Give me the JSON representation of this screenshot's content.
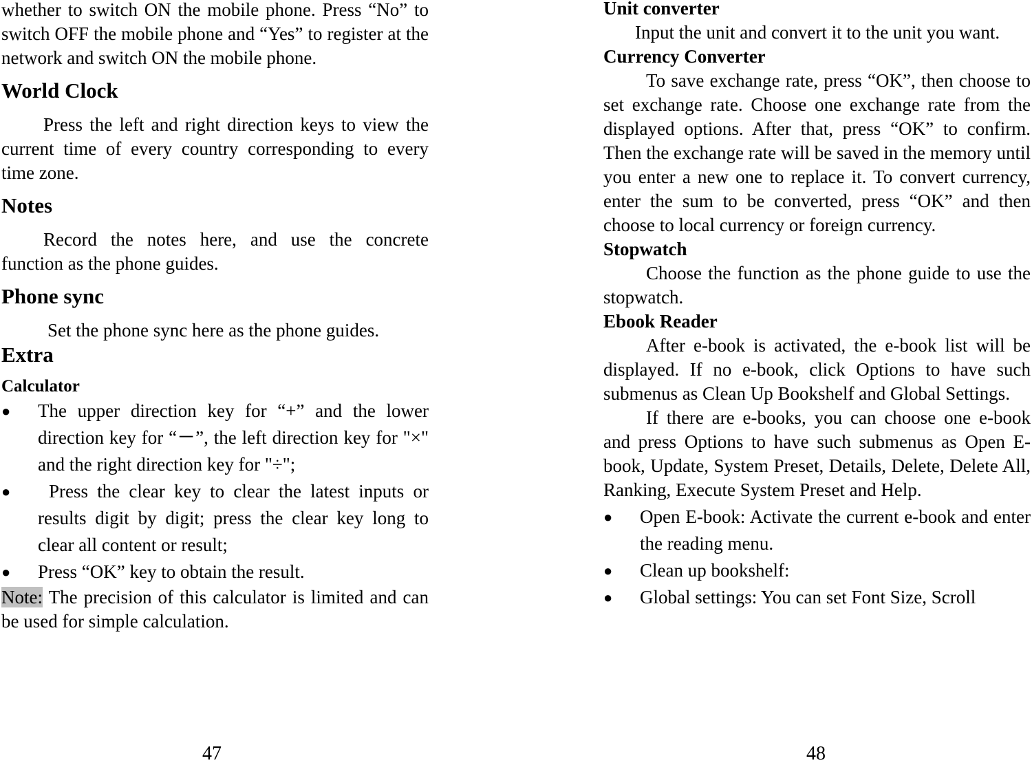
{
  "left_page": {
    "intro_text": "whether to switch ON the mobile phone. Press “No” to switch OFF the mobile phone and “Yes” to register at the network and switch ON the mobile phone.",
    "sections": [
      {
        "heading": "World Clock",
        "body": "Press the left and right direction keys to view the current time of every country corresponding to every time zone."
      },
      {
        "heading": "Notes",
        "body": "Record the notes here, and use the concrete function as the phone guides."
      },
      {
        "heading": "Phone sync",
        "body": "Set the phone sync here as the phone guides."
      }
    ],
    "extra_heading": "Extra",
    "calculator": {
      "heading": "Calculator",
      "bullets": [
        "The upper direction key for “+” and the lower direction key for “－”, the left direction key for \"×\" and the right direction key for \"÷\";",
        "Press the clear key to clear the latest inputs or results digit by digit; press the clear key long to clear all content or result;",
        "Press “OK” key to obtain the result."
      ],
      "note_label": "Note:",
      "note_text": " The precision of this calculator is limited and can be used for simple calculation."
    },
    "page_number": "47"
  },
  "right_page": {
    "unit_converter": {
      "heading": "Unit converter",
      "body": "Input the unit and convert it to the unit you want."
    },
    "currency_converter": {
      "heading": "Currency Converter",
      "body": "To save exchange rate, press “OK”, then choose to set exchange rate. Choose one exchange rate from the displayed options. After that, press “OK” to confirm. Then the exchange rate will be saved in the memory until you enter a new one to replace it. To convert currency, enter the sum to be converted, press “OK” and then choose to local currency or foreign currency."
    },
    "stopwatch": {
      "heading": "Stopwatch",
      "body": "Choose the function as the phone guide to use the stopwatch."
    },
    "ebook_reader": {
      "heading": "Ebook Reader",
      "body1": "After e-book is activated, the e-book list will be displayed. If no e-book, click Options to have such submenus as Clean Up Bookshelf and Global Settings.",
      "body2": "If there are e-books, you can choose one e-book and press Options to have such submenus as Open E-book, Update, System Preset, Details, Delete, Delete All, Ranking, Execute System Preset and Help.",
      "bullets": [
        "Open E-book: Activate the current e-book and enter the reading menu.",
        "Clean up bookshelf:",
        "Global settings: You can set Font Size, Scroll"
      ]
    },
    "page_number": "48"
  },
  "icons": {
    "bullet": "●"
  }
}
